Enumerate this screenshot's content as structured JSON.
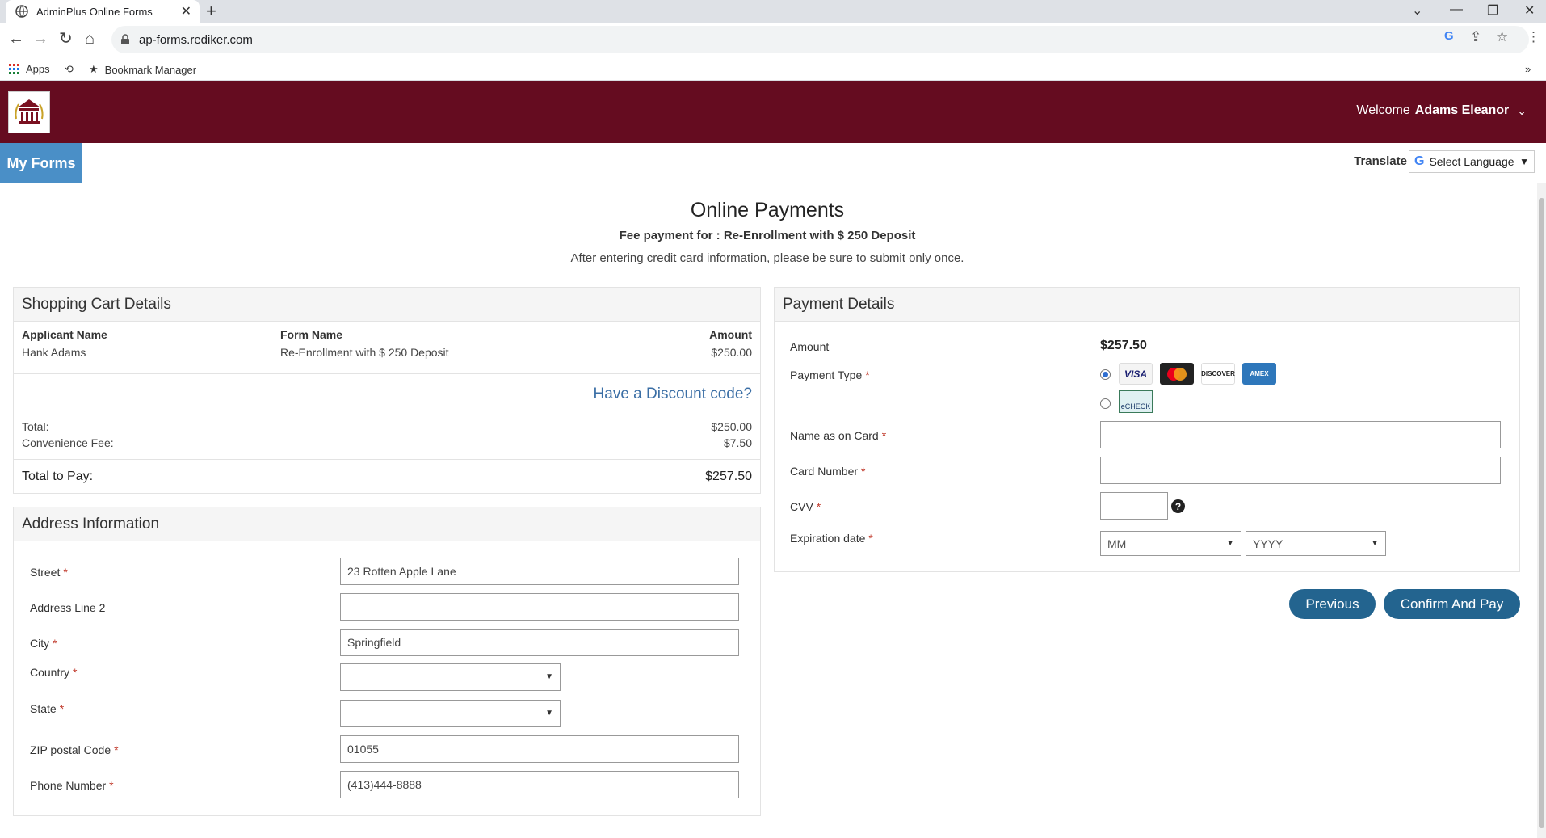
{
  "browser": {
    "tab_title": "AdminPlus Online Forms",
    "url": "ap-forms.rediker.com",
    "bookmarks": [
      {
        "label": "Apps"
      },
      {
        "label": "Bookmark Manager"
      }
    ]
  },
  "header": {
    "welcome_prefix": "Welcome",
    "user_name": "Adams Eleanor"
  },
  "subnav": {
    "my_forms": "My Forms",
    "translate_label": "Translate",
    "language_select": "Select Language"
  },
  "page": {
    "title": "Online Payments",
    "fee_line": "Fee payment for : Re-Enrollment with $ 250 Deposit",
    "note": "After entering credit card information, please be sure to submit only once."
  },
  "cart": {
    "heading": "Shopping Cart Details",
    "col_applicant": "Applicant Name",
    "col_form": "Form Name",
    "col_amount": "Amount",
    "applicant": "Hank Adams",
    "form_name": "Re-Enrollment with $ 250 Deposit",
    "amount": "$250.00",
    "discount_link": "Have a Discount code?",
    "total_label": "Total:",
    "total_value": "$250.00",
    "fee_label": "Convenience Fee:",
    "fee_value": "$7.50",
    "total_pay_label": "Total to Pay:",
    "total_pay_value": "$257.50"
  },
  "address": {
    "heading": "Address Information",
    "street_label": "Street",
    "street_value": "23 Rotten Apple Lane",
    "line2_label": "Address Line 2",
    "line2_value": "",
    "city_label": "City",
    "city_value": "Springfield",
    "country_label": "Country",
    "country_value": "",
    "state_label": "State",
    "state_value": "",
    "zip_label": "ZIP postal Code",
    "zip_value": "01055",
    "phone_label": "Phone Number",
    "phone_value": "(413)444-8888"
  },
  "payment": {
    "heading": "Payment Details",
    "amount_label": "Amount",
    "amount_value": "$257.50",
    "type_label": "Payment Type",
    "cards": [
      "VISA",
      "MC",
      "DISCOVER",
      "AMEX"
    ],
    "echeck_label": "eCHECK",
    "name_label": "Name as on Card",
    "card_number_label": "Card Number",
    "cvv_label": "CVV",
    "expiry_label": "Expiration date",
    "month_placeholder": "MM",
    "year_placeholder": "YYYY"
  },
  "buttons": {
    "previous": "Previous",
    "confirm": "Confirm And Pay"
  },
  "colors": {
    "header_bg": "#650c20",
    "nav_active": "#4a8fc7",
    "button": "#23648f",
    "link": "#3a6ea5"
  }
}
